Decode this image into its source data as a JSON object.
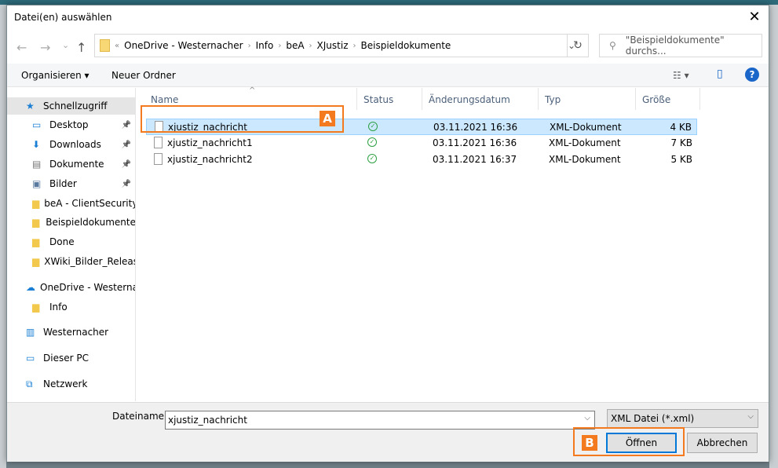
{
  "window": {
    "title": "Datei(en) auswählen",
    "close": "✕"
  },
  "nav": {
    "back": "←",
    "forward": "→",
    "recent": "⌄",
    "up": "↑"
  },
  "address": {
    "prefix": "«",
    "segments": [
      "OneDrive - Westernacher",
      "Info",
      "beA",
      "XJustiz",
      "Beispieldokumente"
    ],
    "dropdown": "⌄",
    "refresh": "↻"
  },
  "search": {
    "placeholder": "\"Beispieldokumente\" durchs..."
  },
  "toolbar": {
    "organize": "Organisieren ▾",
    "new_folder": "Neuer Ordner",
    "view": "☷ ▾",
    "pane": "▯",
    "help": "?"
  },
  "sidebar": {
    "items": [
      {
        "label": "Schnellzugriff",
        "icon": "star-icon",
        "selected": true,
        "pinned": false
      },
      {
        "label": "Desktop",
        "icon": "desktop-icon",
        "pinned": true
      },
      {
        "label": "Downloads",
        "icon": "download-icon",
        "pinned": true
      },
      {
        "label": "Dokumente",
        "icon": "documents-icon",
        "pinned": true
      },
      {
        "label": "Bilder",
        "icon": "pictures-icon",
        "pinned": true
      },
      {
        "label": "beA - ClientSecurity",
        "icon": "folder-icon",
        "pinned": false
      },
      {
        "label": "Beispieldokumente",
        "icon": "folder-icon",
        "pinned": false
      },
      {
        "label": "Done",
        "icon": "folder-icon",
        "pinned": false
      },
      {
        "label": "XWiki_Bilder_Releas",
        "icon": "folder-icon",
        "pinned": false
      },
      {
        "label": "OneDrive - Westernac",
        "icon": "cloud-icon",
        "pinned": false
      },
      {
        "label": "Info",
        "icon": "folder-icon",
        "pinned": false
      },
      {
        "label": "Westernacher",
        "icon": "building-icon",
        "pinned": false
      },
      {
        "label": "Dieser PC",
        "icon": "computer-icon",
        "pinned": false
      },
      {
        "label": "Netzwerk",
        "icon": "network-icon",
        "pinned": false
      }
    ]
  },
  "table": {
    "sort_indicator": "^",
    "columns": [
      "Name",
      "Status",
      "Änderungsdatum",
      "Typ",
      "Größe"
    ],
    "rows": [
      {
        "name": "xjustiz_nachricht",
        "status": "synced",
        "date": "03.11.2021 16:36",
        "type": "XML-Dokument",
        "size": "4 KB",
        "selected": true
      },
      {
        "name": "xjustiz_nachricht1",
        "status": "synced",
        "date": "03.11.2021 16:36",
        "type": "XML-Dokument",
        "size": "7 KB"
      },
      {
        "name": "xjustiz_nachricht2",
        "status": "synced",
        "date": "03.11.2021 16:37",
        "type": "XML-Dokument",
        "size": "5 KB"
      }
    ]
  },
  "footer": {
    "filename_label": "Dateiname:",
    "filename_value": "xjustiz_nachricht",
    "filetype": "XML Datei (*.xml)",
    "open": "Öffnen",
    "cancel": "Abbrechen"
  },
  "annotations": {
    "a": "A",
    "b": "B",
    "color": "#f47a20"
  }
}
